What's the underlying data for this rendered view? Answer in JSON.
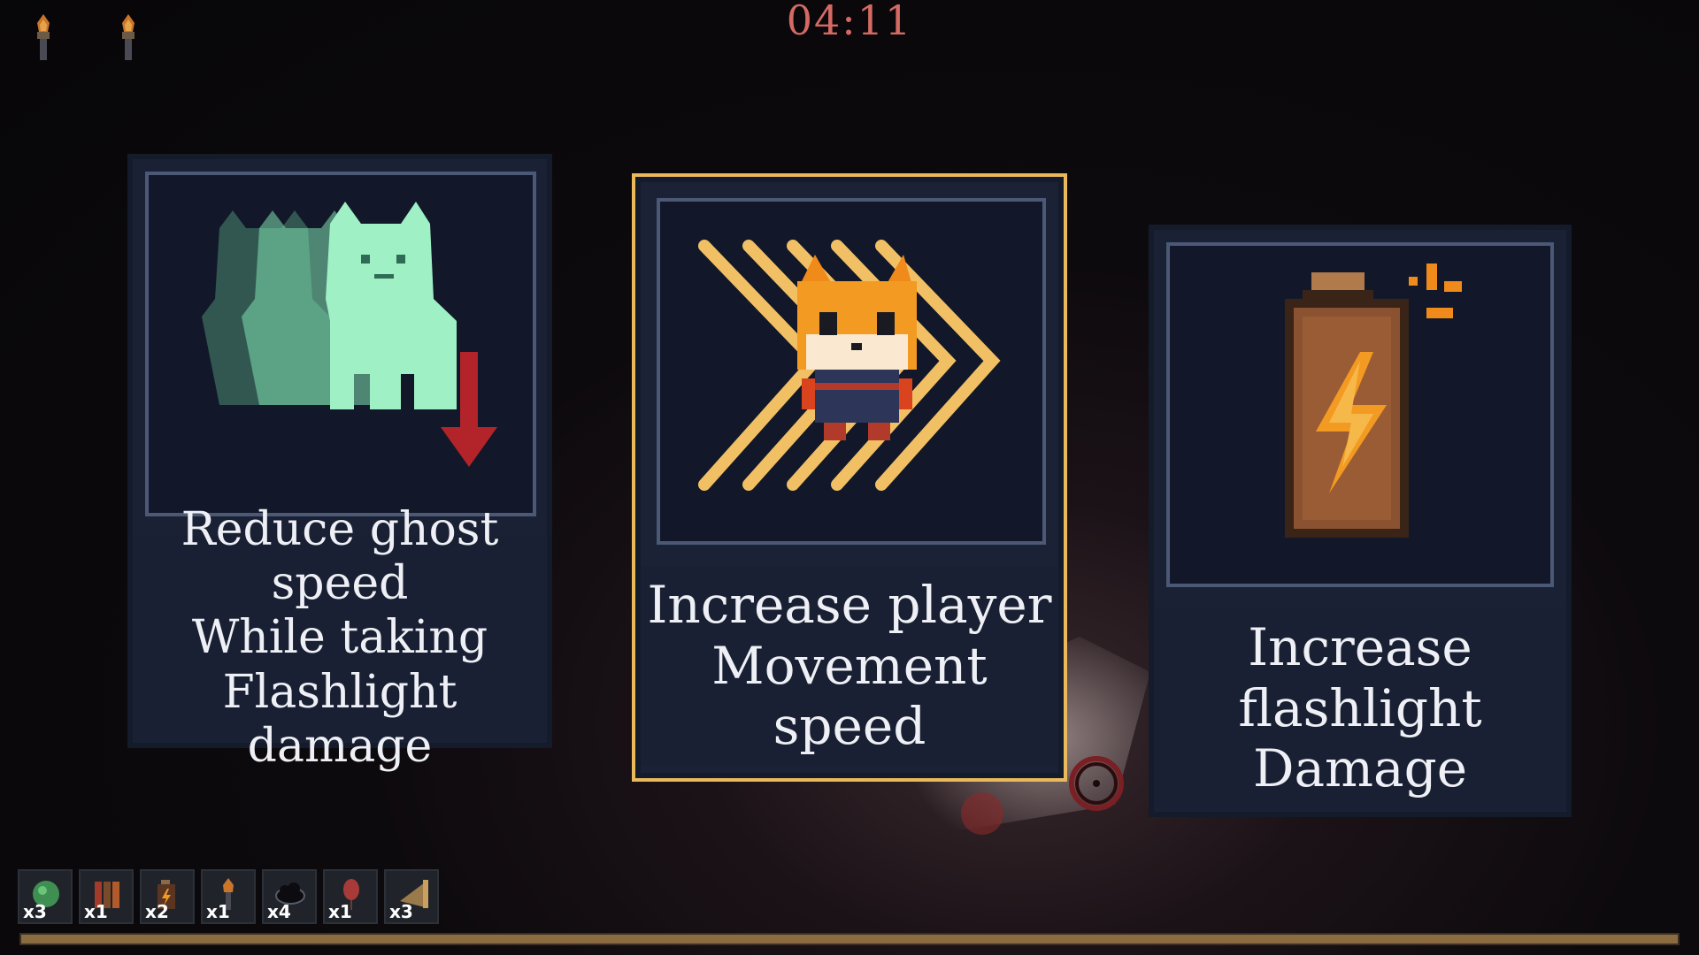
{
  "hud": {
    "timer": "04:11",
    "torches": [
      "torch-icon",
      "torch-icon"
    ],
    "xp_progress": 1.0
  },
  "upgrade_cards": [
    {
      "icon": "ghost-slow-icon",
      "lines": [
        "Reduce ghost speed",
        "While taking",
        "Flashlight damage"
      ],
      "selected": false
    },
    {
      "icon": "fox-speed-icon",
      "lines": [
        "Increase player",
        "Movement speed"
      ],
      "selected": true
    },
    {
      "icon": "battery-icon",
      "lines": [
        "Increase flashlight",
        "Damage"
      ],
      "selected": false
    }
  ],
  "inventory": [
    {
      "icon": "green-orb-icon",
      "count": "x3"
    },
    {
      "icon": "books-icon",
      "count": "x1"
    },
    {
      "icon": "battery-small-icon",
      "count": "x2"
    },
    {
      "icon": "torch-icon",
      "count": "x1"
    },
    {
      "icon": "dark-cloud-icon",
      "count": "x4"
    },
    {
      "icon": "red-balloon-icon",
      "count": "x1"
    },
    {
      "icon": "flashlight-cone-icon",
      "count": "x3"
    }
  ],
  "colors": {
    "timer": "#d36a63",
    "selected_border": "#e9b95b",
    "card_bg": "#1a2134",
    "xp_bar": "#8a6c40"
  }
}
